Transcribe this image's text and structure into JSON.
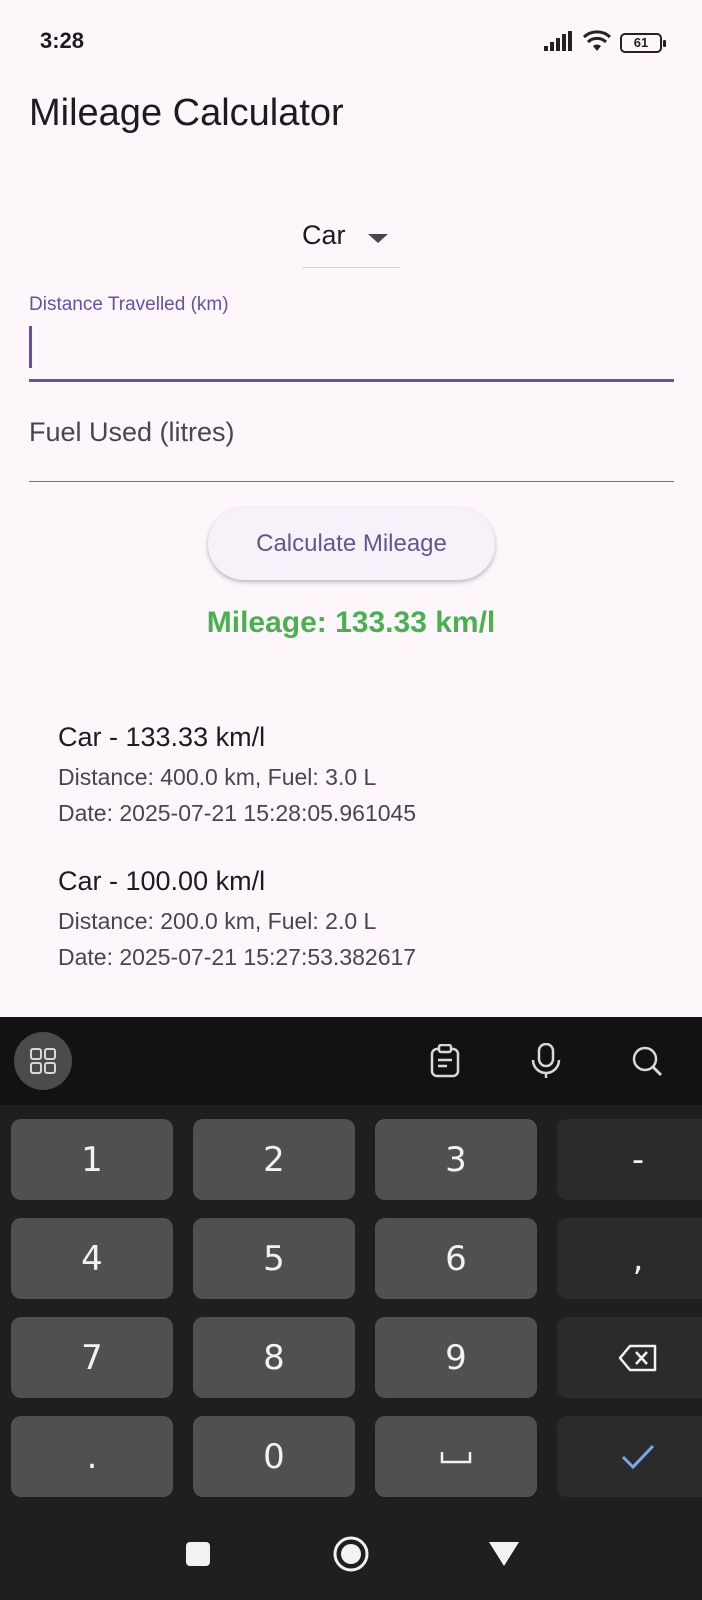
{
  "status_bar": {
    "time": "3:28",
    "battery": "61",
    "icons": [
      "signal-icon",
      "wifi-icon",
      "battery-icon"
    ]
  },
  "app_bar": {
    "title": "Mileage Calculator"
  },
  "vehicle_dropdown": {
    "selected": "Car"
  },
  "distance_field": {
    "label": "Distance Travelled (km)",
    "value": ""
  },
  "fuel_field": {
    "label": "Fuel Used (litres)",
    "value": ""
  },
  "calculate_button": {
    "label": "Calculate Mileage"
  },
  "result": {
    "text": "Mileage: 133.33 km/l",
    "color": "#4caf50"
  },
  "history": [
    {
      "title": "Car - 133.33 km/l",
      "details": "Distance: 400.0 km, Fuel: 3.0 L",
      "date": "Date: 2025-07-21 15:28:05.961045"
    },
    {
      "title": "Car - 100.00 km/l",
      "details": "Distance: 200.0 km, Fuel: 2.0 L",
      "date": "Date: 2025-07-21 15:27:53.382617"
    }
  ],
  "keyboard": {
    "toolbar_icons": [
      "apps-grid-icon",
      "clipboard-icon",
      "microphone-icon",
      "search-icon"
    ],
    "keys": [
      [
        "1",
        "2",
        "3",
        "-"
      ],
      [
        "4",
        "5",
        "6",
        ","
      ],
      [
        "7",
        "8",
        "9",
        "⌫"
      ],
      [
        ".",
        "0",
        "␣",
        "✓"
      ]
    ]
  },
  "nav_bar": {
    "icons": [
      "recents-icon",
      "home-icon",
      "back-icon"
    ]
  },
  "colors": {
    "accent": "#6750a4",
    "background": "#fdf7fc",
    "keyboard_bg": "#1f1f1f"
  }
}
